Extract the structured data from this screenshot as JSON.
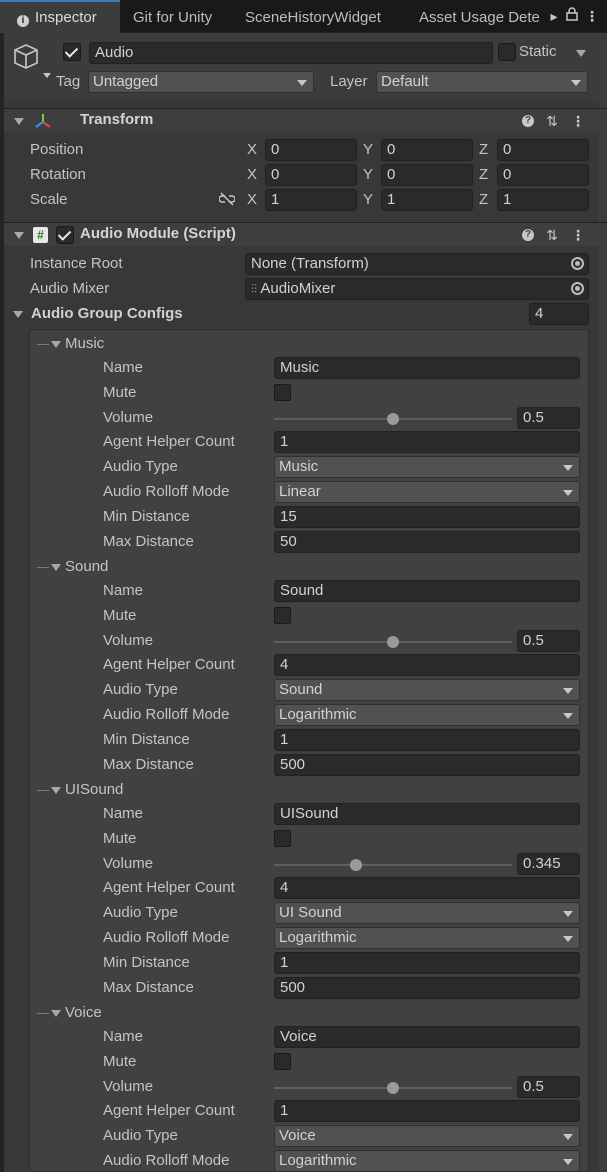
{
  "tabs": [
    {
      "label": "Inspector",
      "active": true
    },
    {
      "label": "Git for Unity",
      "active": false
    },
    {
      "label": "SceneHistoryWidget",
      "active": false
    },
    {
      "label": "Asset Usage Dete",
      "active": false
    }
  ],
  "header": {
    "object_name": "Audio",
    "active": true,
    "static_label": "Static",
    "static_checked": false,
    "tag_label": "Tag",
    "tag_value": "Untagged",
    "layer_label": "Layer",
    "layer_value": "Default"
  },
  "transform": {
    "title": "Transform",
    "rows": [
      {
        "label": "Position",
        "x": "0",
        "y": "0",
        "z": "0"
      },
      {
        "label": "Rotation",
        "x": "0",
        "y": "0",
        "z": "0"
      },
      {
        "label": "Scale",
        "x": "1",
        "y": "1",
        "z": "1"
      }
    ],
    "axis_x": "X",
    "axis_y": "Y",
    "axis_z": "Z"
  },
  "audio_module": {
    "title": "Audio Module (Script)",
    "enabled": true,
    "instance_root_label": "Instance Root",
    "instance_root_value": "None (Transform)",
    "audio_mixer_label": "Audio Mixer",
    "audio_mixer_value": "AudioMixer",
    "configs_label": "Audio Group Configs",
    "configs_count": "4",
    "field_labels": {
      "name": "Name",
      "mute": "Mute",
      "volume": "Volume",
      "helper": "Agent Helper Count",
      "type": "Audio Type",
      "rolloff": "Audio Rolloff Mode",
      "min": "Min Distance",
      "max": "Max Distance"
    },
    "groups": [
      {
        "title": "Music",
        "name": "Music",
        "mute": false,
        "volume": "0.5",
        "volume_frac": 0.5,
        "helper": "1",
        "type": "Music",
        "rolloff": "Linear",
        "min": "15",
        "max": "50"
      },
      {
        "title": "Sound",
        "name": "Sound",
        "mute": false,
        "volume": "0.5",
        "volume_frac": 0.5,
        "helper": "4",
        "type": "Sound",
        "rolloff": "Logarithmic",
        "min": "1",
        "max": "500"
      },
      {
        "title": "UISound",
        "name": "UISound",
        "mute": false,
        "volume": "0.345",
        "volume_frac": 0.345,
        "helper": "4",
        "type": "UI Sound",
        "rolloff": "Logarithmic",
        "min": "1",
        "max": "500"
      },
      {
        "title": "Voice",
        "name": "Voice",
        "mute": false,
        "volume": "0.5",
        "volume_frac": 0.5,
        "helper": "1",
        "type": "Voice",
        "rolloff": "Logarithmic"
      }
    ]
  },
  "colors": {
    "accent": "#3a79bb",
    "panel": "#383838",
    "field": "#2a2a2a"
  }
}
